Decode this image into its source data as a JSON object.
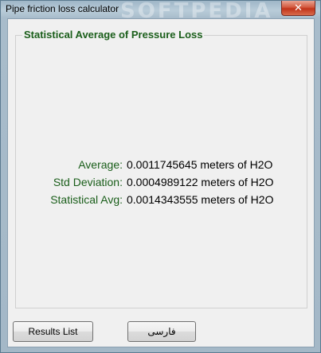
{
  "window": {
    "title": "Pipe friction loss calculator",
    "watermark": "SOFTPEDIA",
    "close_glyph": "✕"
  },
  "group": {
    "title": "Statistical Average of Pressure Loss"
  },
  "results": [
    {
      "label": "Average:",
      "value": "0.0011745645 meters of H2O"
    },
    {
      "label": "Std Deviation:",
      "value": "0.0004989122 meters of H2O"
    },
    {
      "label": "Statistical Avg:",
      "value": "0.0014343555 meters of H2O"
    }
  ],
  "buttons": {
    "results_list": "Results List",
    "farsi": "فارسی"
  }
}
